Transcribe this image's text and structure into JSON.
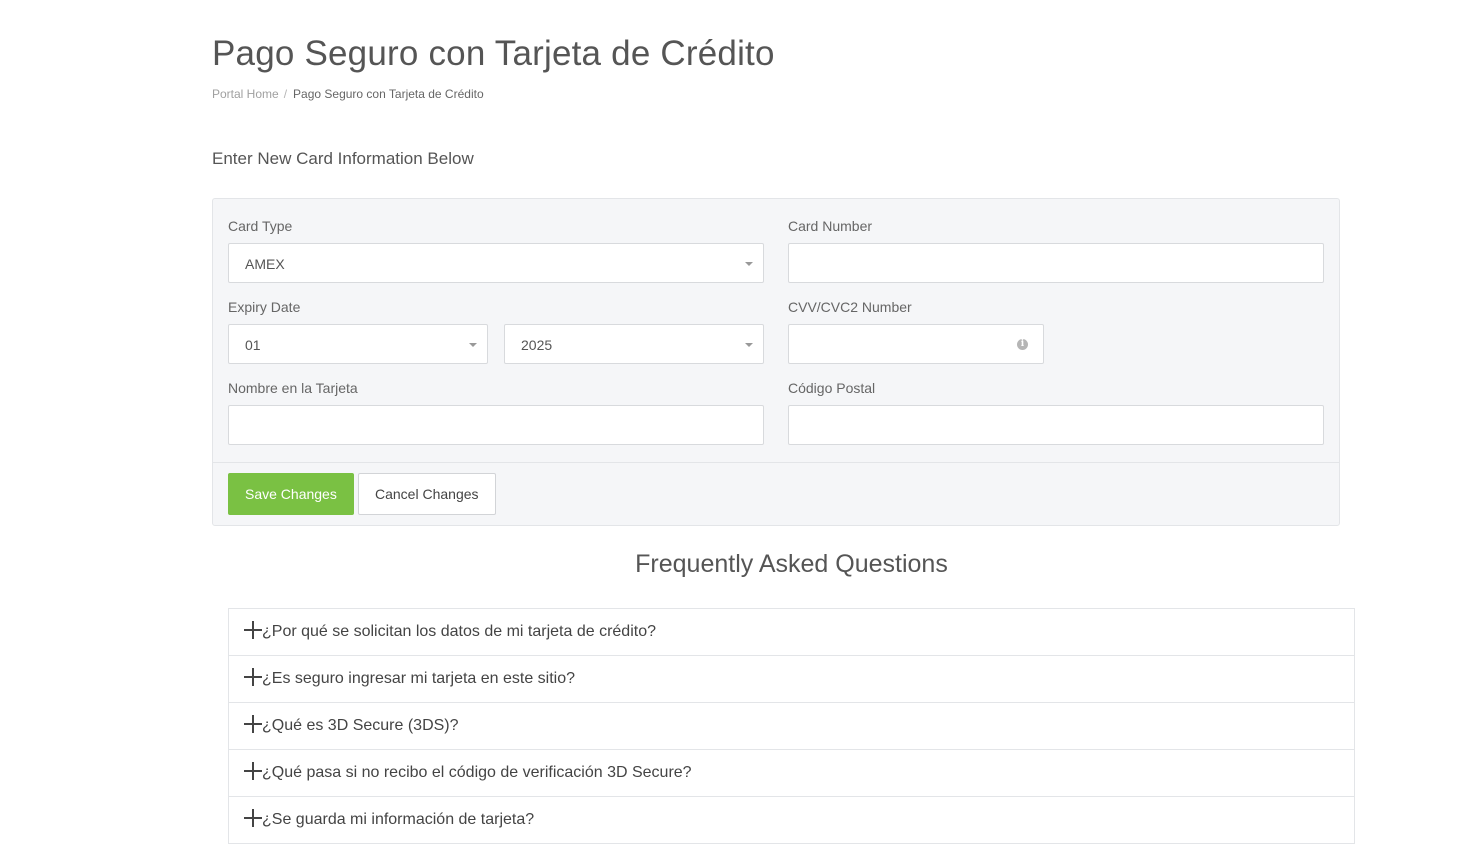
{
  "page": {
    "title": "Pago Seguro con Tarjeta de Crédito",
    "breadcrumb": {
      "home": "Portal Home",
      "separator": "/",
      "current": "Pago Seguro con Tarjeta de Crédito"
    }
  },
  "form": {
    "heading": "Enter New Card Information Below",
    "card_type": {
      "label": "Card Type",
      "value": "AMEX"
    },
    "card_number": {
      "label": "Card Number",
      "value": ""
    },
    "expiry": {
      "label": "Expiry Date",
      "month": "01",
      "year": "2025"
    },
    "cvv": {
      "label": "CVV/CVC2 Number",
      "value": "",
      "icon": "info-icon"
    },
    "name_on_card": {
      "label": "Nombre en la Tarjeta",
      "value": ""
    },
    "postal_code": {
      "label": "Código Postal",
      "value": ""
    },
    "save_label": "Save Changes",
    "cancel_label": "Cancel Changes"
  },
  "faq": {
    "title": "Frequently Asked Questions",
    "items": [
      {
        "question": "¿Por qué se solicitan los datos de mi tarjeta de crédito?"
      },
      {
        "question": "¿Es seguro ingresar mi tarjeta en este sitio?"
      },
      {
        "question": "¿Qué es 3D Secure (3DS)?"
      },
      {
        "question": "¿Qué pasa si no recibo el código de verificación 3D Secure?"
      },
      {
        "question": "¿Se guarda mi información de tarjeta?"
      }
    ]
  },
  "colors": {
    "primary_button": "#7ac143",
    "panel_background": "#f5f6f8"
  }
}
